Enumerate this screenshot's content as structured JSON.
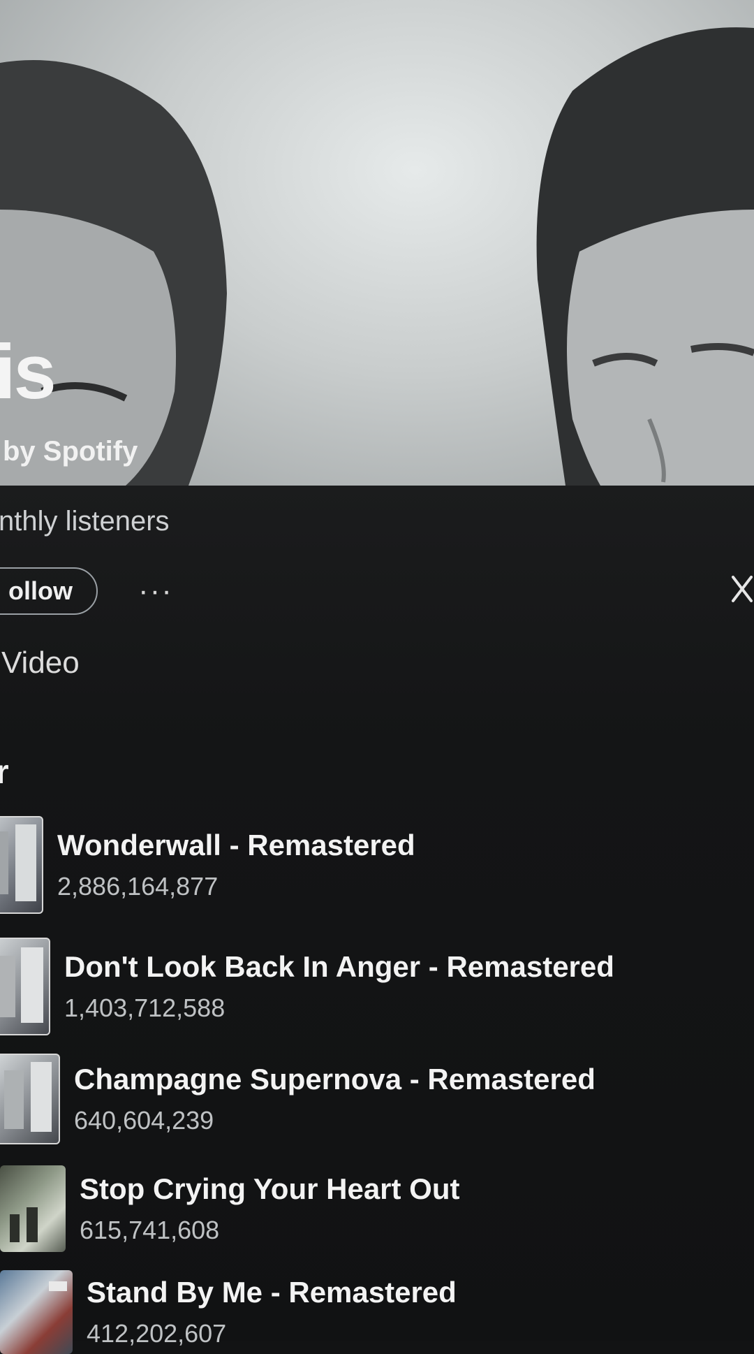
{
  "artist": {
    "name": "is",
    "verified_label": "by Spotify",
    "listeners_label": "nthly listeners"
  },
  "actions": {
    "follow_label": "ollow",
    "more_label": "···"
  },
  "tabs": {
    "video_label": "Video"
  },
  "section": {
    "heading": "r"
  },
  "tracks": [
    {
      "title": "Wonderwall - Remastered",
      "plays": "2,886,164,877"
    },
    {
      "title": "Don't Look Back In Anger - Remastered",
      "plays": "1,403,712,588"
    },
    {
      "title": "Champagne Supernova - Remastered",
      "plays": "640,604,239"
    },
    {
      "title": "Stop Crying Your Heart Out",
      "plays": "615,741,608"
    },
    {
      "title": "Stand By Me - Remastered",
      "plays": "412,202,607"
    }
  ],
  "icons": {
    "more": "more-horizontal-icon",
    "close": "close-icon"
  }
}
